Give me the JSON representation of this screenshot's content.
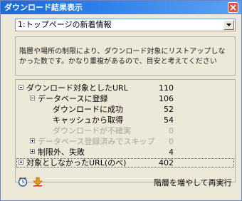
{
  "window": {
    "title": "ダウンロード結果表示",
    "close_icon": "close-icon"
  },
  "selector": {
    "value": "1:トップページの新着情報"
  },
  "info": {
    "text": "階層や場所の制限により、ダウンロード対象にリストアップしなかった数です。かなり重複があるので、目安と考えてください"
  },
  "tree": {
    "rows": [
      {
        "label": "ダウンロード対象としたURL",
        "value": "110",
        "toggle": "minus",
        "disabled": false
      },
      {
        "label": "データベースに登録",
        "value": "106",
        "toggle": "minus",
        "disabled": false
      },
      {
        "label": "ダウンロードに成功",
        "value": "52",
        "toggle": "",
        "disabled": false
      },
      {
        "label": "キャッシュから取得",
        "value": "54",
        "toggle": "",
        "disabled": false
      },
      {
        "label": "ダウンロードが不確実",
        "value": "0",
        "toggle": "",
        "disabled": true
      },
      {
        "label": "データベース登録済みでスキップ",
        "value": "0",
        "toggle": "plus",
        "disabled": true
      },
      {
        "label": "制限外、失敗",
        "value": "4",
        "toggle": "plus",
        "disabled": false
      },
      {
        "label": "対象としなかったURL(のべ)",
        "value": "402",
        "toggle": "plus",
        "disabled": false
      }
    ]
  },
  "footer": {
    "icons": [
      "clock-icon",
      "download-icon"
    ],
    "rerun_label": "階層を増やして再実行"
  },
  "colors": {
    "titlebar": "#2f7fea",
    "background": "#ece9d8",
    "close": "#d9543b",
    "disabled_text": "#a8a697"
  }
}
